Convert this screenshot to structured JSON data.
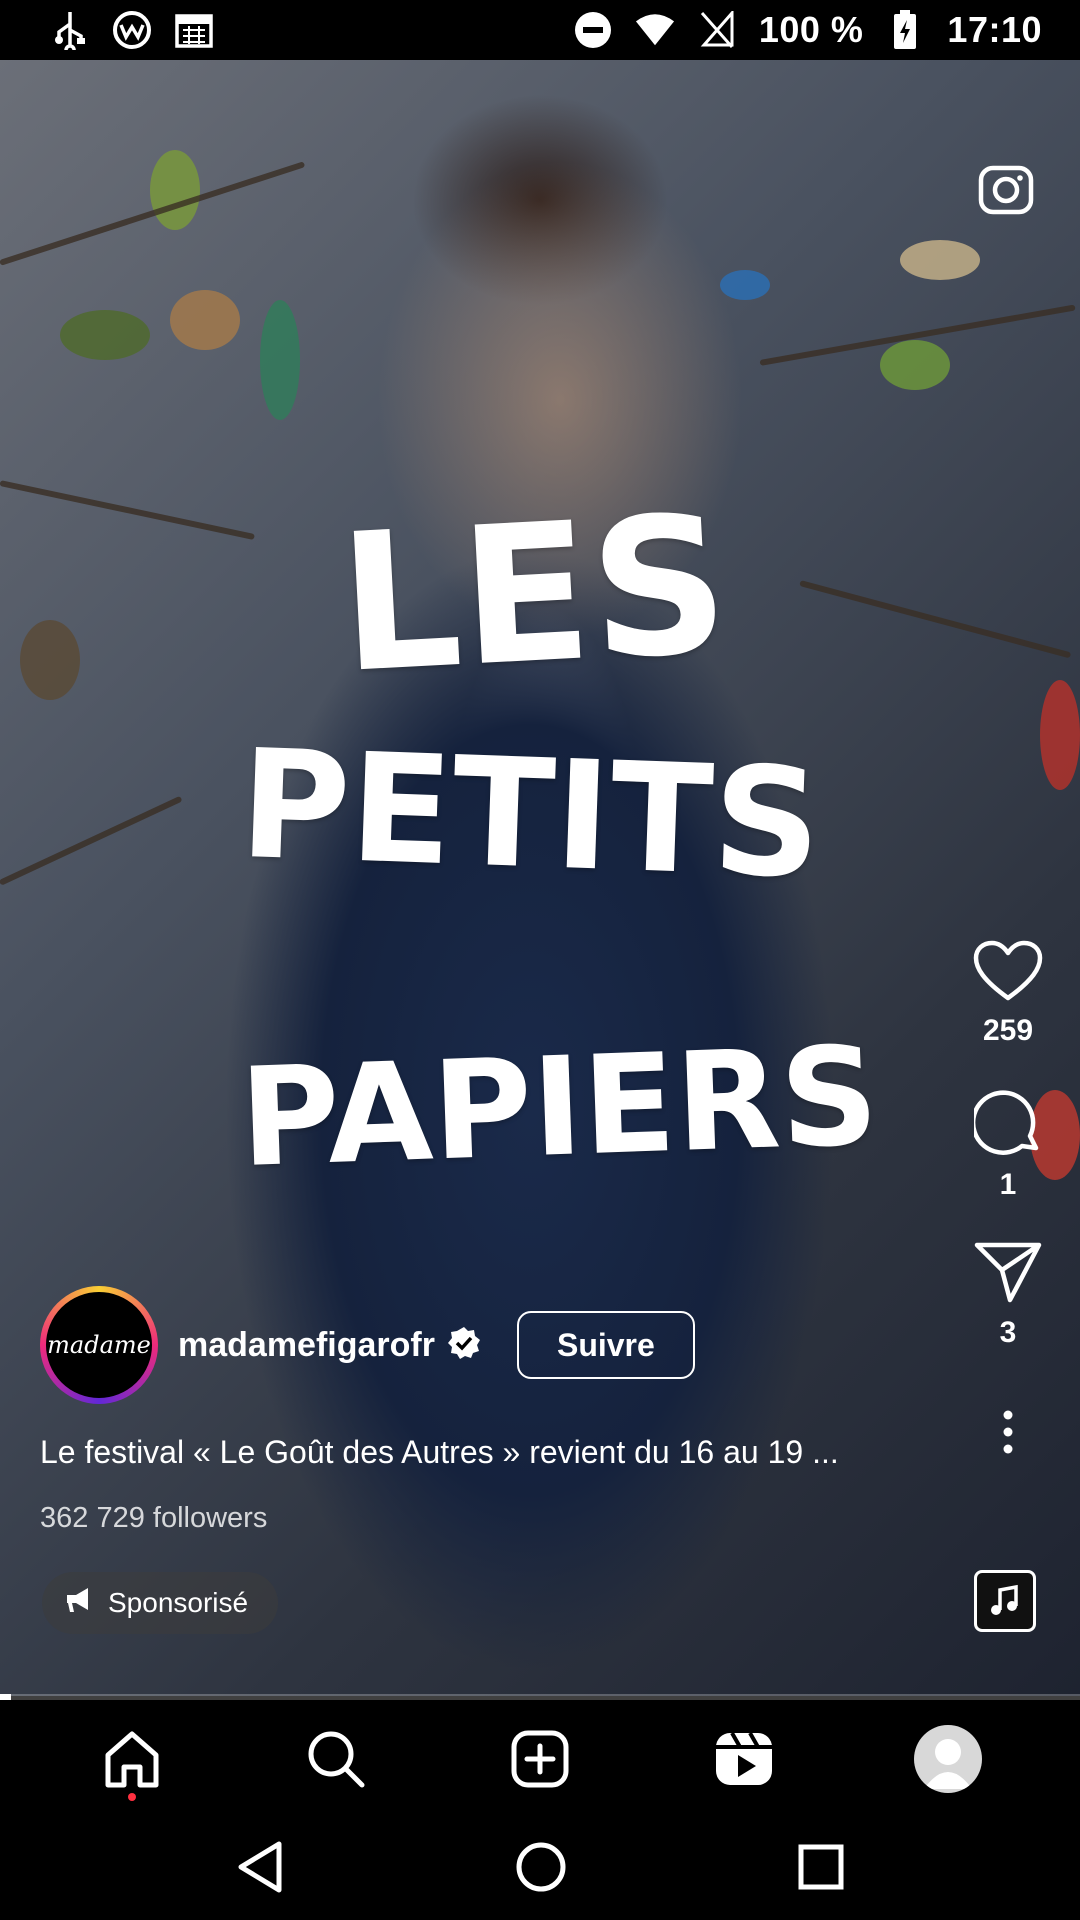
{
  "status_bar": {
    "battery": "100 %",
    "time": "17:10",
    "icons": [
      "usb-icon",
      "vpn-icon",
      "calendar-icon",
      "dnd-icon",
      "wifi-icon",
      "no-sim-icon",
      "battery-charging-icon"
    ]
  },
  "reel": {
    "poster_text": [
      "LES",
      "PETITS",
      "PAPIERS"
    ],
    "account": {
      "avatar_text": "madame",
      "username": "madamefigarofr",
      "verified": true,
      "follow_label": "Suivre"
    },
    "caption": "Le festival « Le Goût des Autres » revient du 16 au 19 ...",
    "followers": "362 729 followers",
    "sponsored_label": "Sponsorisé",
    "actions": {
      "likes": "259",
      "comments": "1",
      "shares": "3"
    },
    "progress_fraction": 0.01
  },
  "bottom_nav": [
    "home-icon",
    "search-icon",
    "create-icon",
    "reels-icon",
    "profile-icon"
  ],
  "system_nav": [
    "back-icon",
    "home-circle-icon",
    "recents-icon"
  ],
  "colors": {
    "notification_dot": "#ff3040",
    "avatar_ring": [
      "#f9ce34",
      "#ee2a7b",
      "#6228d7"
    ]
  }
}
